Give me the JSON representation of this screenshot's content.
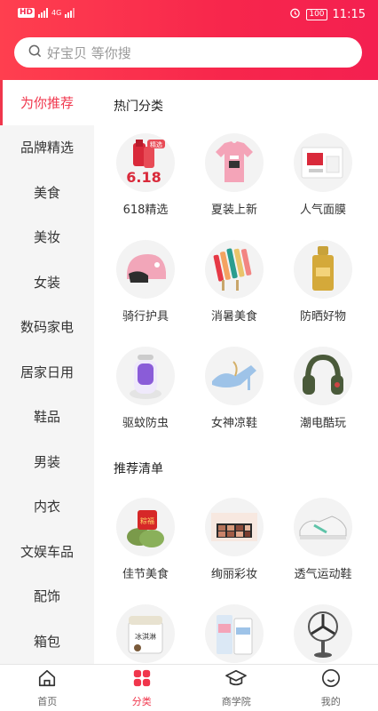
{
  "status_bar": {
    "carrier_chips": [
      "HD",
      "4G"
    ],
    "alarm_icon": "alarm-icon",
    "battery": "100",
    "time": "11:15"
  },
  "search": {
    "placeholder": "好宝贝 等你搜",
    "icon": "search-icon"
  },
  "sidebar": {
    "active_index": 0,
    "items": [
      {
        "label": "为你推荐"
      },
      {
        "label": "品牌精选"
      },
      {
        "label": "美食"
      },
      {
        "label": "美妆"
      },
      {
        "label": "女装"
      },
      {
        "label": "数码家电"
      },
      {
        "label": "居家日用"
      },
      {
        "label": "鞋品"
      },
      {
        "label": "男装"
      },
      {
        "label": "内衣"
      },
      {
        "label": "文娱车品"
      },
      {
        "label": "配饰"
      },
      {
        "label": "箱包"
      }
    ]
  },
  "sections": {
    "hot": {
      "title": "热门分类",
      "items": [
        {
          "label": "618精选",
          "badge": "精选",
          "badge_text": "6.18"
        },
        {
          "label": "夏装上新"
        },
        {
          "label": "人气面膜"
        },
        {
          "label": "骑行护具"
        },
        {
          "label": "消暑美食"
        },
        {
          "label": "防晒好物"
        },
        {
          "label": "驱蚊防虫"
        },
        {
          "label": "女神凉鞋"
        },
        {
          "label": "潮电酷玩"
        }
      ]
    },
    "recommend": {
      "title": "推荐清单",
      "items": [
        {
          "label": "佳节美食",
          "badge": "粽福"
        },
        {
          "label": "绚丽彩妆"
        },
        {
          "label": "透气运动鞋"
        },
        {
          "label": "",
          "badge": "冰淇淋"
        },
        {
          "label": ""
        },
        {
          "label": ""
        }
      ]
    }
  },
  "tabbar": {
    "active_index": 1,
    "items": [
      {
        "label": "首页",
        "icon": "home-icon"
      },
      {
        "label": "分类",
        "icon": "category-icon"
      },
      {
        "label": "商学院",
        "icon": "graduation-cap-icon"
      },
      {
        "label": "我的",
        "icon": "profile-icon"
      }
    ]
  },
  "colors": {
    "accent": "#f0364c",
    "header_start": "#ff3f4f",
    "header_end": "#f42050"
  }
}
